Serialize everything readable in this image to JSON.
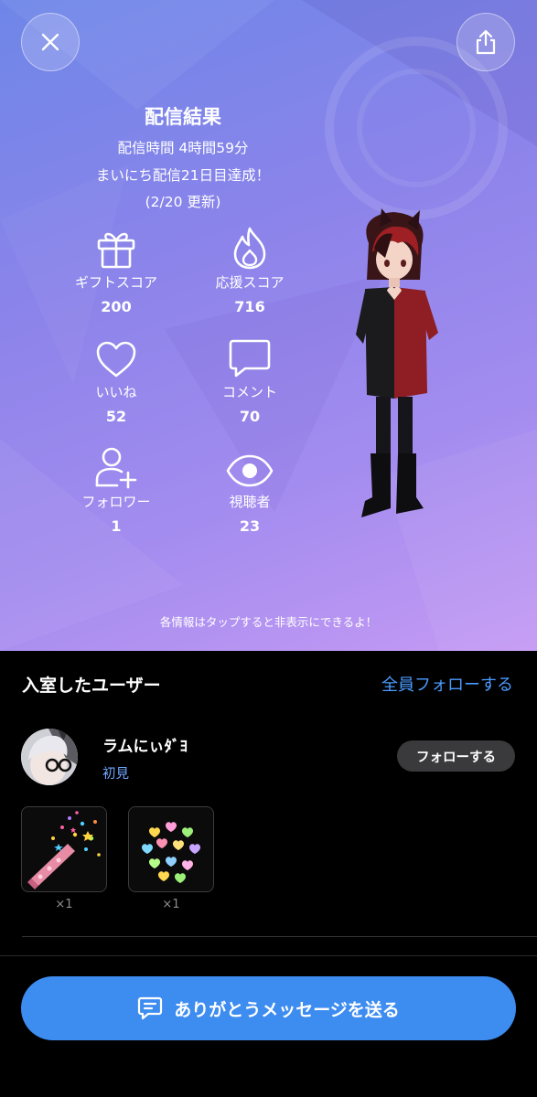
{
  "header": {
    "close_icon": "close-icon",
    "share_icon": "share-icon"
  },
  "result": {
    "title": "配信結果",
    "duration": "配信時間 4時間59分",
    "streak": "まいにち配信21日目達成！",
    "updated": "(2/20 更新)"
  },
  "stats": [
    {
      "icon": "gift-icon",
      "label": "ギフトスコア",
      "value": "200"
    },
    {
      "icon": "flame-icon",
      "label": "応援スコア",
      "value": "716"
    },
    {
      "icon": "heart-icon",
      "label": "いいね",
      "value": "52"
    },
    {
      "icon": "comment-icon",
      "label": "コメント",
      "value": "70"
    },
    {
      "icon": "follower-icon",
      "label": "フォロワー",
      "value": "1"
    },
    {
      "icon": "eye-icon",
      "label": "視聴者",
      "value": "23"
    }
  ],
  "hint": "各情報はタップすると非表示にできるよ！",
  "entered_users": {
    "title": "入室したユーザー",
    "follow_all": "全員フォローする",
    "users": [
      {
        "name": "ラムにぃﾀﾞﾖ",
        "tag": "初見",
        "follow_label": "フォローする"
      }
    ],
    "gifts": [
      {
        "icon": "party-popper-icon",
        "count": "×1"
      },
      {
        "icon": "hearts-icon",
        "count": "×1"
      }
    ]
  },
  "cta": {
    "icon": "message-icon",
    "label": "ありがとうメッセージを送る"
  },
  "colors": {
    "accent_blue": "#3d8cf0",
    "link_blue": "#4a9bff",
    "tag_blue": "#6fa8ff"
  }
}
